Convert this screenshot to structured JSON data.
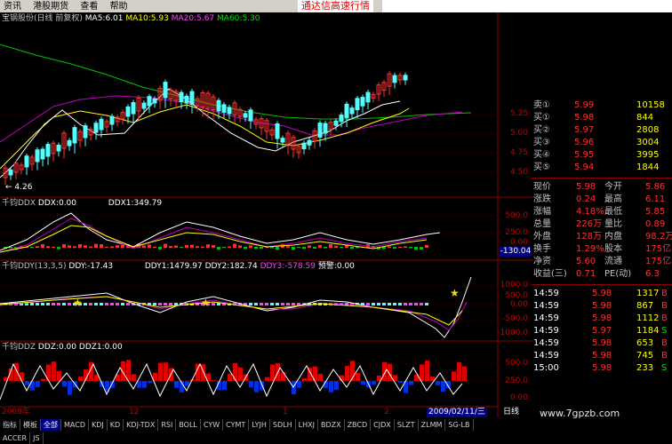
{
  "menu": [
    "资讯",
    "港股期货",
    "查看",
    "帮助"
  ],
  "ad_text": "通达信高速行情",
  "main_chart": {
    "title": "宝钢股份(日线 前复权)",
    "ma5": "MA5:6.01",
    "ma10": "MA10:5.93",
    "ma20": "MA20:5.67",
    "ma60": "MA60:5.30",
    "low_marker": "← 4.26",
    "y_ticks": [
      "5.25",
      "5.00",
      "4.75",
      "4.50"
    ]
  },
  "ddx_panel": {
    "title": "千钧DDX",
    "ddx": "DDX:0.00",
    "ddx1": "DDX1:349.79",
    "y_ticks": [
      "500.0",
      "250.0",
      "0.00"
    ],
    "current": "-130.04"
  },
  "ddy_panel": {
    "title": "千钧DDY(13,3,5)",
    "ddy": "DDY:-17.43",
    "ddy1": "DDY1:1479.97",
    "ddy2": "DDY2:182.74",
    "ddy3": "DDY3:-578.59",
    "warn": "预警:0.00",
    "y_ticks": [
      "1000.0",
      "500.0",
      "0.00",
      "-500.0",
      "-1000.0"
    ]
  },
  "ddz_panel": {
    "title": "千钧DDZ",
    "ddz": "DDZ:0.00",
    "ddz1": "DDZ1:0.00",
    "y_ticks": [
      "500.0",
      "250.0",
      "0.00"
    ]
  },
  "x_axis": {
    "left": "2008年",
    "mid1": "12",
    "mid2": "1",
    "mid3": "2",
    "date": "2009/02/11/三",
    "period": "日线"
  },
  "quotes": {
    "orders": [
      {
        "label": "卖①",
        "price": "5.99",
        "vol": "10158"
      },
      {
        "label": "买①",
        "price": "5.98",
        "vol": "844"
      },
      {
        "label": "买②",
        "price": "5.97",
        "vol": "2808"
      },
      {
        "label": "买③",
        "price": "5.96",
        "vol": "3004"
      },
      {
        "label": "买④",
        "price": "5.95",
        "vol": "3995"
      },
      {
        "label": "买⑤",
        "price": "5.94",
        "vol": "1844"
      }
    ],
    "stats": [
      {
        "k1": "现价",
        "v1": "5.98",
        "k2": "今开",
        "v2": "5.86"
      },
      {
        "k1": "涨跌",
        "v1": "0.24",
        "k2": "最高",
        "v2": "6.11"
      },
      {
        "k1": "涨幅",
        "v1": "4.18%",
        "k2": "最低",
        "v2": "5.85"
      },
      {
        "k1": "总量",
        "v1": "226万",
        "k2": "量比",
        "v2": "0.89"
      },
      {
        "k1": "外盘",
        "v1": "128万",
        "k2": "内盘",
        "v2": "98.2万"
      },
      {
        "k1": "换手",
        "v1": "1.29%",
        "k2": "股本",
        "v2": "175亿"
      },
      {
        "k1": "净资",
        "v1": "5.60",
        "k2": "流通",
        "v2": "175亿"
      },
      {
        "k1": "收益(三)",
        "v1": "0.71",
        "k2": "PE(动)",
        "v2": "6.3"
      }
    ],
    "ticks": [
      {
        "time": "14:59",
        "price": "5.98",
        "vol": "1317",
        "flag": "B"
      },
      {
        "time": "14:59",
        "price": "5.98",
        "vol": "867",
        "flag": "B"
      },
      {
        "time": "14:59",
        "price": "5.98",
        "vol": "1112",
        "flag": "B"
      },
      {
        "time": "14:59",
        "price": "5.97",
        "vol": "1184",
        "flag": "S"
      },
      {
        "time": "14:59",
        "price": "5.98",
        "vol": "653",
        "flag": "B"
      },
      {
        "time": "14:59",
        "price": "5.98",
        "vol": "745",
        "flag": "B"
      },
      {
        "time": "15:00",
        "price": "5.98",
        "vol": "233",
        "flag": "S"
      }
    ]
  },
  "tabs": [
    "指标",
    "模板",
    "全部",
    "MACD",
    "KDJ",
    "KD",
    "KDJ-TDX",
    "RSI",
    "BOLL",
    "CYW",
    "CYMT",
    "LYJH",
    "SDLH",
    "LHXJ",
    "BDZX",
    "ZBCD",
    "CJDX",
    "SLZT",
    "ZLMM",
    "SG-LB",
    "ACCER",
    "JS"
  ],
  "watermark": "www.7gpzb.com"
}
